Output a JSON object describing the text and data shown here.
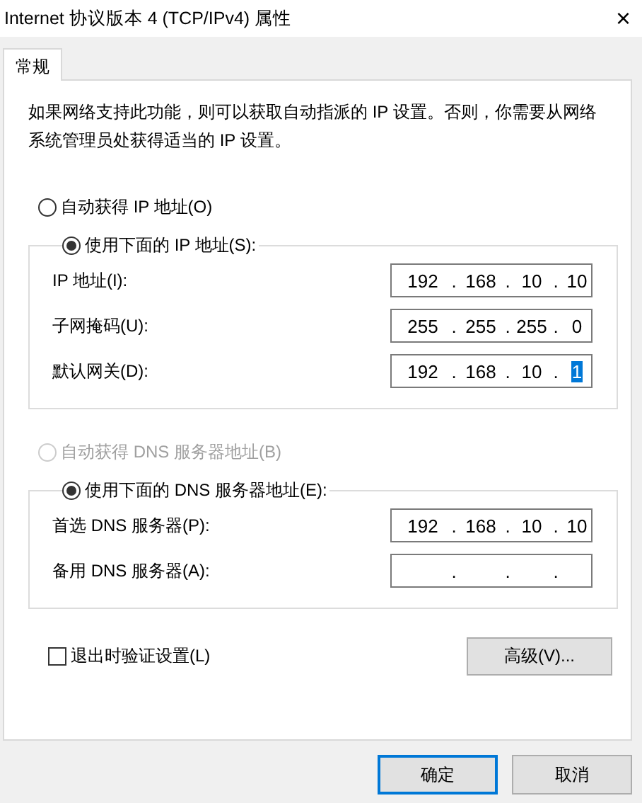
{
  "window": {
    "title": "Internet 协议版本 4 (TCP/IPv4) 属性",
    "close": "×"
  },
  "tabs": [
    {
      "label": "常规",
      "selected": true
    }
  ],
  "description": "如果网络支持此功能，则可以获取自动指派的 IP 设置。否则，你需要从网络系统管理员处获得适当的 IP 设置。",
  "ip_section": {
    "auto": {
      "label": "自动获得 IP 地址(O)",
      "selected": false,
      "disabled": false
    },
    "manual": {
      "label": "使用下面的 IP 地址(S):",
      "selected": true,
      "disabled": false
    },
    "fields": [
      {
        "label": "IP 地址(I):",
        "dots": [
          ".",
          ".",
          "."
        ],
        "octets": [
          {
            "text": "192",
            "selected": false
          },
          {
            "text": "168",
            "selected": false
          },
          {
            "text": "10",
            "selected": false
          },
          {
            "text": "10",
            "selected": false
          }
        ]
      },
      {
        "label": "子网掩码(U):",
        "dots": [
          ".",
          ".",
          "."
        ],
        "octets": [
          {
            "text": "255",
            "selected": false
          },
          {
            "text": "255",
            "selected": false
          },
          {
            "text": "255",
            "selected": false
          },
          {
            "text": "0",
            "selected": false
          }
        ]
      },
      {
        "label": "默认网关(D):",
        "dots": [
          ".",
          ".",
          "."
        ],
        "octets": [
          {
            "text": "192",
            "selected": false
          },
          {
            "text": "168",
            "selected": false
          },
          {
            "text": "10",
            "selected": false
          },
          {
            "text": "1",
            "selected": true
          }
        ]
      }
    ]
  },
  "dns_section": {
    "auto": {
      "label": "自动获得 DNS 服务器地址(B)",
      "selected": false,
      "disabled": true
    },
    "manual": {
      "label": "使用下面的 DNS 服务器地址(E):",
      "selected": true,
      "disabled": false
    },
    "fields": [
      {
        "label": "首选 DNS 服务器(P):",
        "dots": [
          ".",
          ".",
          "."
        ],
        "octets": [
          {
            "text": "192",
            "selected": false
          },
          {
            "text": "168",
            "selected": false
          },
          {
            "text": "10",
            "selected": false
          },
          {
            "text": "10",
            "selected": false
          }
        ]
      },
      {
        "label": "备用 DNS 服务器(A):",
        "dots": [
          ".",
          ".",
          "."
        ]
      }
    ]
  },
  "validate": {
    "label": "退出时验证设置(L)",
    "checked": false
  },
  "advanced_button": "高级(V)...",
  "buttons": [
    {
      "label": "确定",
      "default": true
    },
    {
      "label": "取消",
      "default": false
    }
  ]
}
